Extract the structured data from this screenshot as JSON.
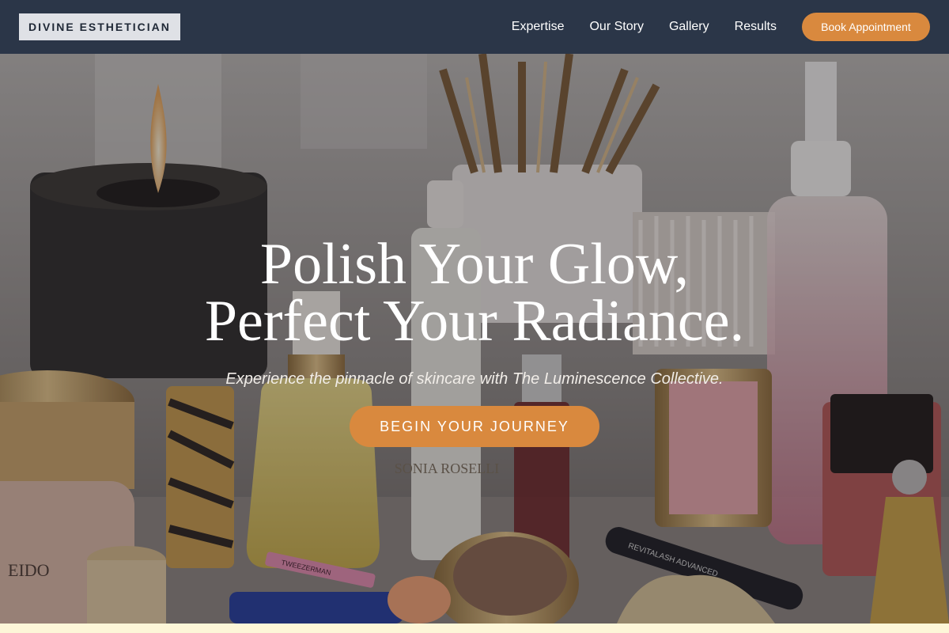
{
  "nav": {
    "logo": "DIVINE ESTHETICIAN",
    "links": [
      "Expertise",
      "Our Story",
      "Gallery",
      "Results"
    ],
    "book_label": "Book Appointment"
  },
  "hero": {
    "headline_line1": "Polish Your Glow,",
    "headline_line2": "Perfect Your Radiance.",
    "subline": "Experience the pinnacle of skincare with The Luminescence Collective.",
    "cta_label": "BEGIN YOUR JOURNEY"
  },
  "product_text": {
    "serum_brand": "SONIA ROSELLI",
    "lash_label": "REVITALASH ADVANCED",
    "tweezer_label": "TWEEZERMAN",
    "jar_label": "EIDO"
  },
  "colors": {
    "nav_bg": "#2b3648",
    "accent": "#d9893e",
    "text_light": "#ffffff"
  }
}
